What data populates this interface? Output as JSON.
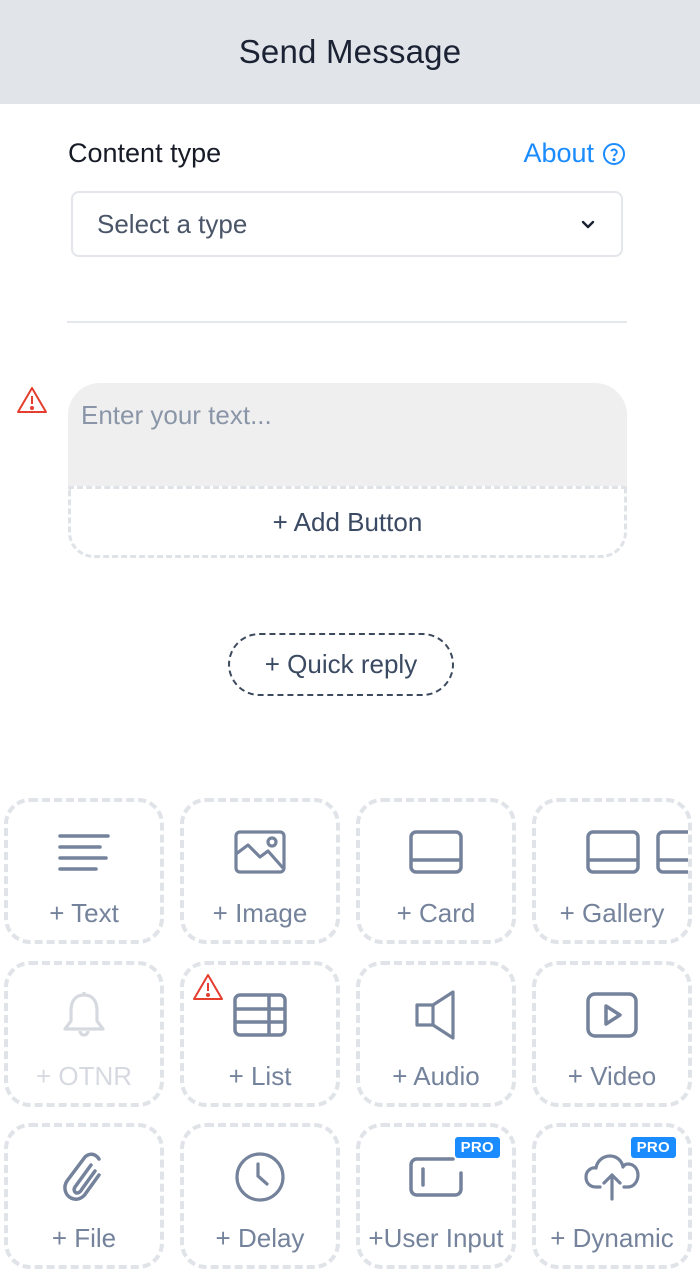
{
  "header": {
    "title": "Send Message"
  },
  "content_type": {
    "label": "Content type",
    "about_label": "About",
    "select_value": "Select a type"
  },
  "text_block": {
    "placeholder": "Enter your text...",
    "add_button_label": "+ Add Button",
    "has_warning": true
  },
  "quick_reply": {
    "label": "+ Quick reply"
  },
  "colors": {
    "accent": "#1a8cff",
    "warning": "#e53e2e",
    "icon": "#74839b",
    "disabled": "#d6dae0",
    "header_bg": "#e1e4e9"
  },
  "tiles": [
    {
      "label": "+ Text",
      "icon": "text-lines-icon"
    },
    {
      "label": "+ Image",
      "icon": "image-icon"
    },
    {
      "label": "+ Card",
      "icon": "card-icon"
    },
    {
      "label": "+ Gallery",
      "icon": "gallery-icon"
    },
    {
      "label": "+ OTNR",
      "icon": "bell-icon",
      "disabled": true
    },
    {
      "label": "+ List",
      "icon": "list-table-icon",
      "warning": true
    },
    {
      "label": "+ Audio",
      "icon": "speaker-icon"
    },
    {
      "label": "+ Video",
      "icon": "video-play-icon"
    },
    {
      "label": "+ File",
      "icon": "paperclip-icon"
    },
    {
      "label": "+ Delay",
      "icon": "clock-icon"
    },
    {
      "label": "+User Input",
      "icon": "text-input-icon",
      "badge": "PRO"
    },
    {
      "label": "+ Dynamic",
      "icon": "cloud-upload-icon",
      "badge": "PRO"
    }
  ]
}
